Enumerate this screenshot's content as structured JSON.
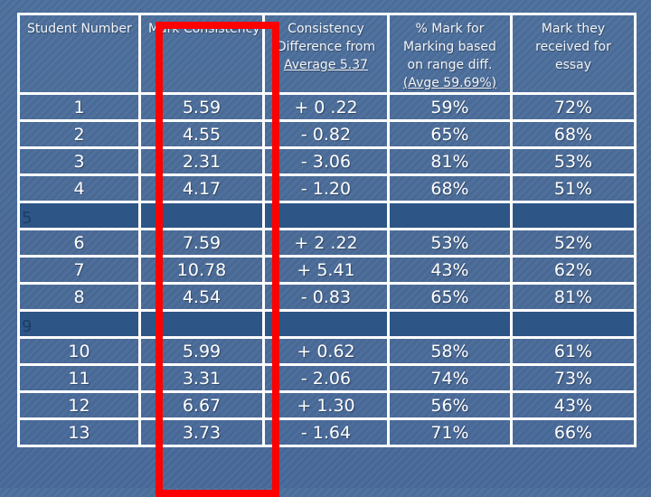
{
  "table": {
    "headers": [
      {
        "lines": [
          "Student Number"
        ],
        "underline": []
      },
      {
        "lines": [
          "Mark Consistency"
        ],
        "underline": []
      },
      {
        "lines": [
          "Consistency",
          "Difference from",
          "Average 5.37"
        ],
        "underline": [
          2
        ]
      },
      {
        "lines": [
          "% Mark for",
          "Marking based",
          "on range diff.",
          "(Avge 59.69%)"
        ],
        "underline": [
          3
        ]
      },
      {
        "lines": [
          "Mark they",
          "received for",
          "essay"
        ],
        "underline": []
      }
    ],
    "rows": [
      {
        "student": "1",
        "consistency": "5.59",
        "difference": "+ 0 .22",
        "pct_marking": "59%",
        "essay_mark": "72%"
      },
      {
        "student": "2",
        "consistency": "4.55",
        "difference": "- 0.82",
        "pct_marking": "65%",
        "essay_mark": "68%"
      },
      {
        "student": "3",
        "consistency": "2.31",
        "difference": "- 3.06",
        "pct_marking": "81%",
        "essay_mark": "53%"
      },
      {
        "student": "4",
        "consistency": "4.17",
        "difference": "- 1.20",
        "pct_marking": "68%",
        "essay_mark": "51%"
      },
      {
        "student": "5",
        "consistency": "",
        "difference": "",
        "pct_marking": "",
        "essay_mark": "",
        "empty": true
      },
      {
        "student": "6",
        "consistency": "7.59",
        "difference": "+ 2 .22",
        "pct_marking": "53%",
        "essay_mark": "52%"
      },
      {
        "student": "7",
        "consistency": "10.78",
        "difference": "+ 5.41",
        "pct_marking": "43%",
        "essay_mark": "62%"
      },
      {
        "student": "8",
        "consistency": "4.54",
        "difference": "- 0.83",
        "pct_marking": "65%",
        "essay_mark": "81%"
      },
      {
        "student": "9",
        "consistency": "",
        "difference": "",
        "pct_marking": "",
        "essay_mark": "",
        "empty": true
      },
      {
        "student": "10",
        "consistency": "5.99",
        "difference": "+ 0.62",
        "pct_marking": "58%",
        "essay_mark": "61%"
      },
      {
        "student": "11",
        "consistency": "3.31",
        "difference": "- 2.06",
        "pct_marking": "74%",
        "essay_mark": "73%"
      },
      {
        "student": "12",
        "consistency": "6.67",
        "difference": "+ 1.30",
        "pct_marking": "56%",
        "essay_mark": "43%"
      },
      {
        "student": "13",
        "consistency": "3.73",
        "difference": "- 1.64",
        "pct_marking": "71%",
        "essay_mark": "66%"
      }
    ]
  },
  "highlight": {
    "column": "Mark Consistency",
    "color": "#ff0000"
  },
  "colors": {
    "background": "#4a6c98",
    "empty_row": "#2d5686",
    "grid": "#ffffff",
    "text": "#ffffff"
  }
}
